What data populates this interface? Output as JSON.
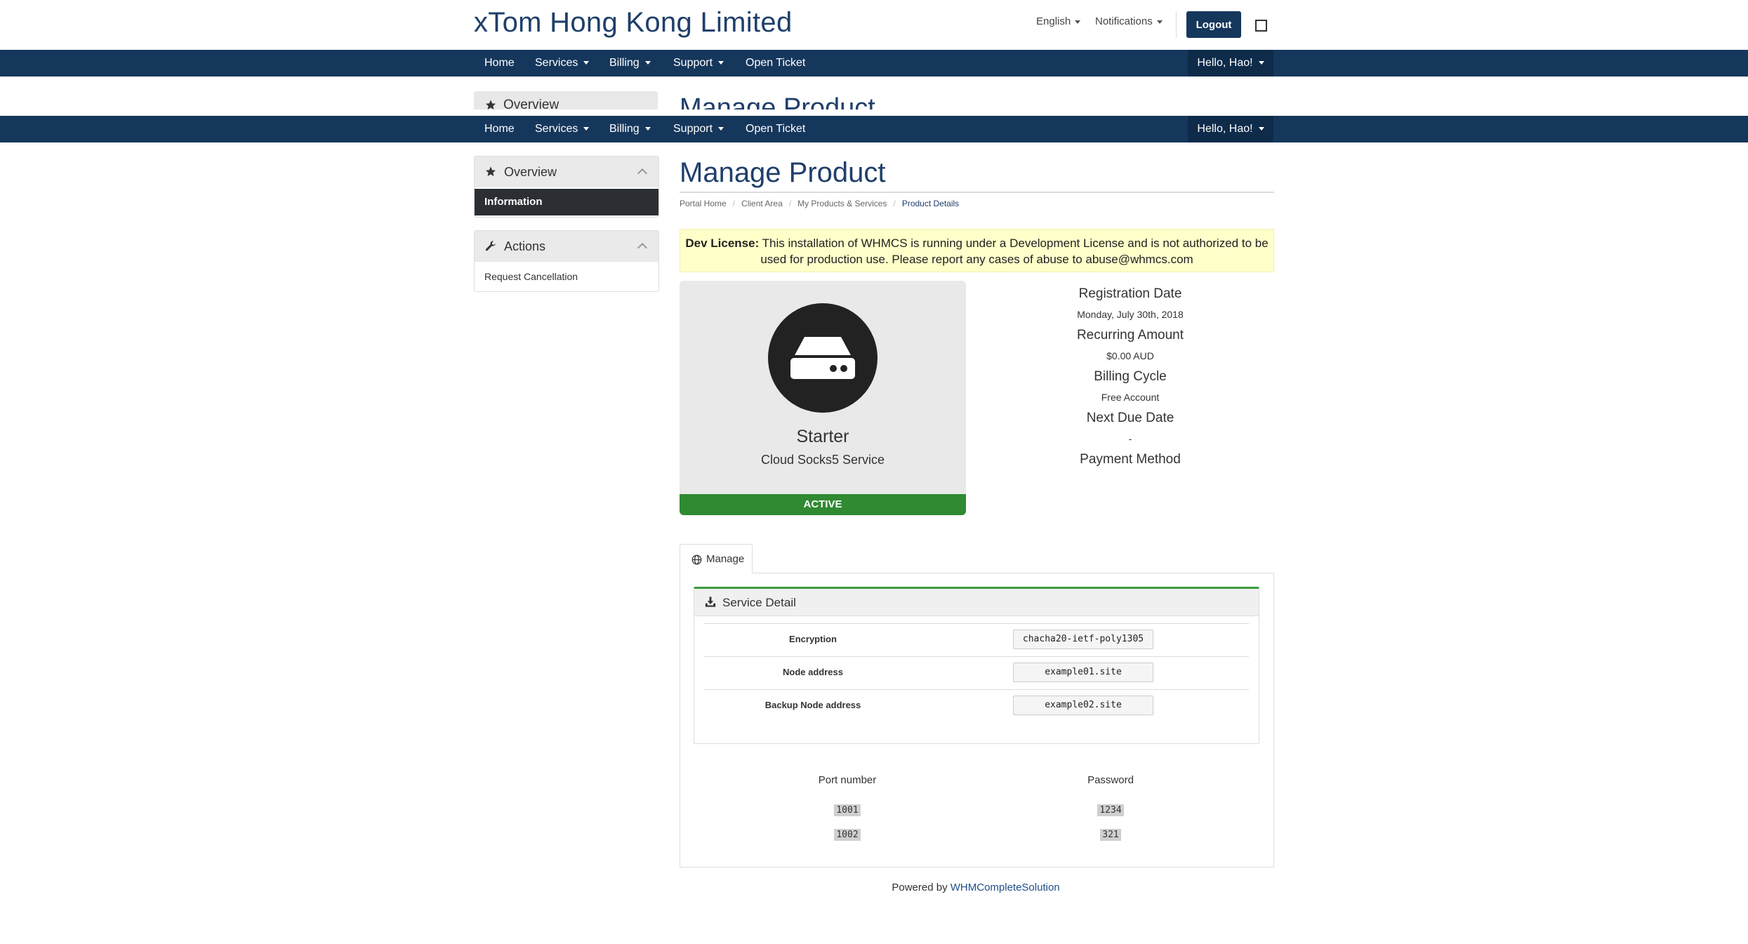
{
  "header": {
    "brand": "xTom Hong Kong Limited",
    "language": "English",
    "notifications": "Notifications",
    "logout": "Logout"
  },
  "navbar": {
    "items": [
      "Home",
      "Services",
      "Billing",
      "Support",
      "Open Ticket"
    ],
    "user": "Hello, Hao!"
  },
  "sidebar": {
    "overview_title": "Overview",
    "overview_active": "Information",
    "actions_title": "Actions",
    "actions_link": "Request Cancellation"
  },
  "main": {
    "title": "Manage Product",
    "breadcrumb": [
      "Portal Home",
      "Client Area",
      "My Products & Services",
      "Product Details"
    ],
    "dev_license_label": "Dev License:",
    "dev_license_text": "This installation of WHMCS is running under a Development License and is not authorized to be used for production use. Please report any cases of abuse to abuse@whmcs.com"
  },
  "product": {
    "name": "Starter",
    "group": "Cloud Socks5 Service",
    "status": "ACTIVE"
  },
  "product_info": {
    "registration_label": "Registration Date",
    "registration_value": "Monday, July 30th, 2018",
    "recurring_label": "Recurring Amount",
    "recurring_value": "$0.00 AUD",
    "cycle_label": "Billing Cycle",
    "cycle_value": "Free Account",
    "due_label": "Next Due Date",
    "due_value": "-",
    "payment_label": "Payment Method"
  },
  "tabs": {
    "manage": "Manage"
  },
  "service_detail": {
    "title": "Service Detail",
    "rows": [
      {
        "label": "Encryption",
        "value": "chacha20-ietf-poly1305"
      },
      {
        "label": "Node address",
        "value": "example01.site"
      },
      {
        "label": "Backup Node address",
        "value": "example02.site"
      }
    ]
  },
  "ports": {
    "port_header": "Port number",
    "password_header": "Password",
    "rows": [
      {
        "port": "1001",
        "password": "1234"
      },
      {
        "port": "1002",
        "password": "321"
      }
    ]
  },
  "footer": {
    "prefix": "Powered by",
    "link": "WHMCompleteSolution"
  },
  "colors": {
    "navbar": "#16375c",
    "brand_text": "#1f3f6a",
    "status_active": "#2f8a31",
    "dev_license_bg": "#ffffca",
    "sidebar_active": "#2b2f33"
  }
}
